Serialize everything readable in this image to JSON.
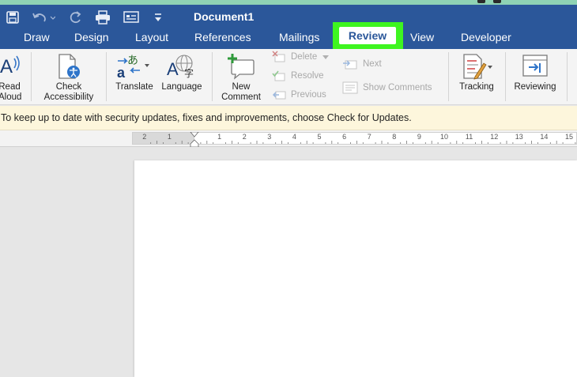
{
  "window": {
    "title": "Document1"
  },
  "quick_access": {
    "icons": [
      "save-icon",
      "undo-icon",
      "redo-icon",
      "print-icon",
      "form-icon",
      "customize-icon"
    ]
  },
  "tabs": [
    {
      "label": "Draw"
    },
    {
      "label": "Design"
    },
    {
      "label": "Layout"
    },
    {
      "label": "References"
    },
    {
      "label": "Mailings"
    },
    {
      "label": "Review",
      "active": true
    },
    {
      "label": "View"
    },
    {
      "label": "Developer"
    }
  ],
  "ribbon": {
    "read_aloud": {
      "line1": "Read",
      "line2": "Aloud"
    },
    "check_accessibility": {
      "line1": "Check",
      "line2": "Accessibility"
    },
    "translate": "Translate",
    "language": "Language",
    "new_comment": {
      "line1": "New",
      "line2": "Comment"
    },
    "delete": "Delete",
    "resolve": "Resolve",
    "previous": "Previous",
    "next": "Next",
    "show_comments": "Show Comments",
    "tracking": "Tracking",
    "reviewing": "Reviewing"
  },
  "message_bar": {
    "text": "To keep up to date with security updates, fixes and improvements, choose Check for Updates."
  },
  "ruler": {
    "left_labels": [
      "2",
      "1"
    ],
    "right_labels": [
      "1",
      "2",
      "3",
      "4",
      "5",
      "6",
      "7",
      "8",
      "9",
      "10",
      "11",
      "12",
      "13",
      "14",
      "15"
    ]
  },
  "colors": {
    "title_bar": "#2b579a",
    "highlight": "#3ef520",
    "message_bar": "#fdf6dc"
  }
}
